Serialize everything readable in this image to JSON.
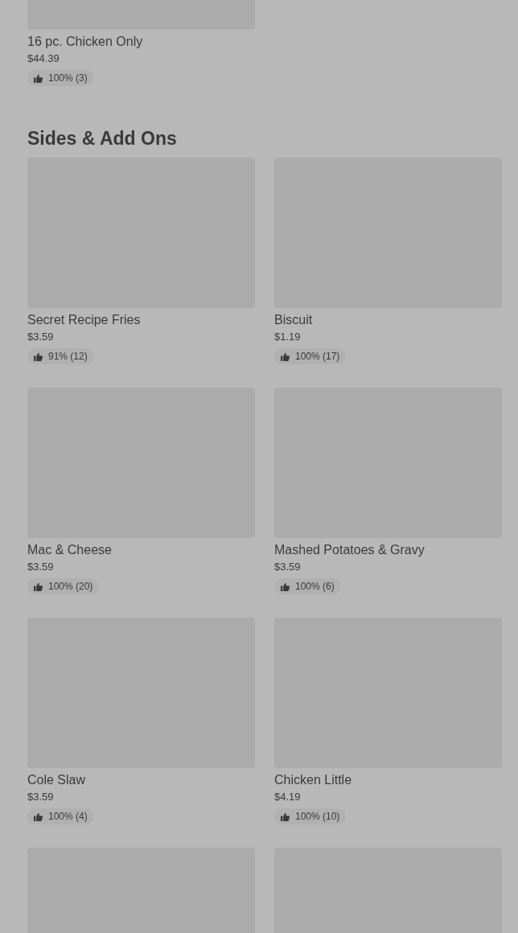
{
  "top_items": [
    {
      "kind": "product",
      "name": "16 pc. Chicken Only",
      "price": "$44.39",
      "rating": "100% (3)"
    }
  ],
  "section": {
    "title": "Sides & Add Ons",
    "items": [
      {
        "kind": "product",
        "name": "Secret Recipe Fries",
        "price": "$3.59",
        "rating": "91% (12)"
      },
      {
        "kind": "product",
        "name": "Biscuit",
        "price": "$1.19",
        "rating": "100% (17)"
      },
      {
        "kind": "product",
        "name": "Mac & Cheese",
        "price": "$3.59",
        "rating": "100% (20)"
      },
      {
        "kind": "product",
        "name": "Mashed Potatoes & Gravy",
        "price": "$3.59",
        "rating": "100% (6)"
      },
      {
        "kind": "product",
        "name": "Cole Slaw",
        "price": "$3.59",
        "rating": "100% (4)"
      },
      {
        "kind": "product",
        "name": "Chicken Little",
        "price": "$4.19",
        "rating": "100% (10)"
      },
      {
        "kind": "image_only"
      },
      {
        "kind": "image_only"
      }
    ]
  }
}
